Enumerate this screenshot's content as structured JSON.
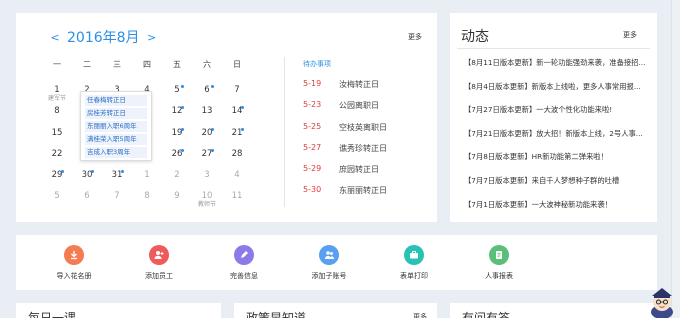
{
  "calendar": {
    "prev": "<",
    "next": ">",
    "title": "2016年8月",
    "more": "更多",
    "weekdays": [
      "一",
      "二",
      "三",
      "四",
      "五",
      "六",
      "日"
    ],
    "day1_sub": "建军节",
    "day10_sub": "教师节",
    "popup": [
      "任春梅转正日",
      "房桂芳转正日",
      "东丽丽入职6周年",
      "满桂荣入职5周年",
      "吉成入职3周年"
    ]
  },
  "pending": {
    "title": "待办事项",
    "items": [
      {
        "date": "5-19",
        "text": "汝梅转正日"
      },
      {
        "date": "5-23",
        "text": "公园离职日"
      },
      {
        "date": "5-25",
        "text": "空枝英离职日"
      },
      {
        "date": "5-27",
        "text": "谯秀珍转正日"
      },
      {
        "date": "5-29",
        "text": "庶园转正日"
      },
      {
        "date": "5-30",
        "text": "东丽丽转正日"
      }
    ]
  },
  "news": {
    "title": "动态",
    "more": "更多",
    "items": [
      "【8月11日版本更新】新一轮功能强劲来袭，准备接招...",
      "【8月4日版本更新】新版本上线啦，更多人事常用报...",
      "【7月27日版本更新】一大波个性化功能来啦!",
      "【7月21日版本更新】放大招！新版本上线，2号人事...",
      "【7月8日版本更新】HR新功能第二弹来啦！",
      "【7月7日版本更新】来自千人梦想种子群的吐槽",
      "【7月1日版本更新】一大波神秘新功能来袭！"
    ]
  },
  "quick": [
    {
      "label": "导入花名册",
      "color": "#f47c52"
    },
    {
      "label": "添加员工",
      "color": "#ef5b5b"
    },
    {
      "label": "完善信息",
      "color": "#8b7be8"
    },
    {
      "label": "添加子账号",
      "color": "#5a9ff0"
    },
    {
      "label": "表单打印",
      "color": "#28c2b4"
    },
    {
      "label": "人事报表",
      "color": "#5bbf7a"
    }
  ],
  "bottom": {
    "c1_title": "每日一课",
    "c2_title": "政策早知道",
    "c2_more": "更多",
    "c3_title": "有问有答"
  }
}
